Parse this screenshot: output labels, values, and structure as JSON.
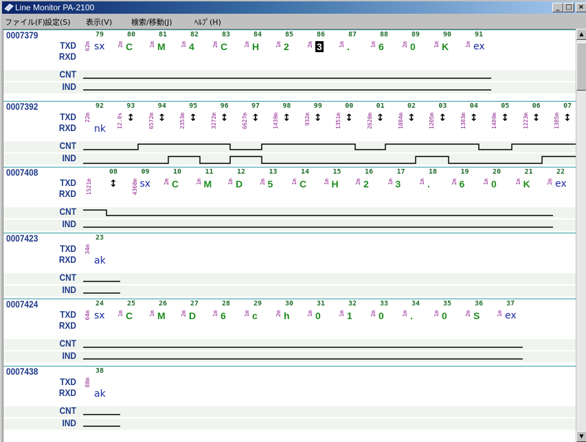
{
  "window": {
    "title": "Line Monitor PA-2100"
  },
  "menu": [
    "ファイル(F)",
    "設定(S)",
    "表示(V)",
    "検索/移動(J)",
    "ﾍﾙﾌﾟ(H)"
  ],
  "labels": [
    "TXD",
    "RXD",
    "CNT",
    "IND"
  ],
  "blocks": [
    {
      "id": "0007379",
      "first_time": "62m",
      "cells": [
        {
          "i": "79",
          "c": "sx",
          "ctl": true
        },
        {
          "i": "80",
          "t": "2m",
          "c": "C"
        },
        {
          "i": "81",
          "t": "1m",
          "c": "M"
        },
        {
          "i": "82",
          "t": "1m",
          "c": "4"
        },
        {
          "i": "83",
          "t": "2m",
          "c": "C"
        },
        {
          "i": "84",
          "t": "1m",
          "c": "H"
        },
        {
          "i": "85",
          "t": "1m",
          "c": "2"
        },
        {
          "i": "86",
          "t": "2m",
          "c": "3",
          "hl": true
        },
        {
          "i": "87",
          "t": "1m",
          "c": "."
        },
        {
          "i": "88",
          "t": "1m",
          "c": "6"
        },
        {
          "i": "89",
          "t": "2m",
          "c": "0"
        },
        {
          "i": "90",
          "t": "1m",
          "c": "K"
        },
        {
          "i": "91",
          "t": "1m",
          "c": "ex",
          "ctl": true
        }
      ]
    },
    {
      "id": "0007392",
      "first_time": "22m",
      "cells": [
        {
          "i": "92",
          "c": "nk",
          "ctl": true,
          "rx": true
        },
        {
          "i": "93",
          "t": "12.0s",
          "arrow": true
        },
        {
          "i": "94",
          "t": "6572m",
          "arrow": true
        },
        {
          "i": "95",
          "t": "2353m",
          "arrow": true
        },
        {
          "i": "96",
          "t": "3272m",
          "arrow": true
        },
        {
          "i": "97",
          "t": "6627m",
          "arrow": true
        },
        {
          "i": "98",
          "t": "1439m",
          "arrow": true
        },
        {
          "i": "99",
          "t": "932m",
          "arrow": true
        },
        {
          "i": "00",
          "t": "1351m",
          "arrow": true
        },
        {
          "i": "01",
          "t": "2620m",
          "arrow": true
        },
        {
          "i": "02",
          "t": "1084m",
          "arrow": true
        },
        {
          "i": "03",
          "t": "1205m",
          "arrow": true
        },
        {
          "i": "04",
          "t": "1383m",
          "arrow": true
        },
        {
          "i": "05",
          "t": "1489m",
          "arrow": true
        },
        {
          "i": "06",
          "t": "1223m",
          "arrow": true
        },
        {
          "i": "07",
          "t": "1385m",
          "arrow": true
        }
      ]
    },
    {
      "id": "0007408",
      "first_time": "1521m",
      "cells": [
        {
          "i": "08",
          "arrow": true
        },
        {
          "i": "09",
          "t": "4368m",
          "c": "sx",
          "ctl": true
        },
        {
          "i": "10",
          "t": "2m",
          "c": "C"
        },
        {
          "i": "11",
          "t": "1m",
          "c": "M"
        },
        {
          "i": "12",
          "t": "1m",
          "c": "D"
        },
        {
          "i": "13",
          "t": "2m",
          "c": "5"
        },
        {
          "i": "14",
          "t": "1m",
          "c": "C"
        },
        {
          "i": "15",
          "t": "1m",
          "c": "H"
        },
        {
          "i": "16",
          "t": "2m",
          "c": "2"
        },
        {
          "i": "17",
          "t": "1m",
          "c": "3"
        },
        {
          "i": "18",
          "t": "1m",
          "c": "."
        },
        {
          "i": "19",
          "t": "2m",
          "c": "6"
        },
        {
          "i": "20",
          "t": "1m",
          "c": "0"
        },
        {
          "i": "21",
          "t": "1m",
          "c": "K"
        },
        {
          "i": "22",
          "t": "2m",
          "c": "ex",
          "ctl": true
        }
      ]
    },
    {
      "id": "0007423",
      "first_time": "34m",
      "cells": [
        {
          "i": "23",
          "c": "ak",
          "ctl": true,
          "rx": true
        }
      ]
    },
    {
      "id": "0007424",
      "first_time": "64m",
      "cells": [
        {
          "i": "24",
          "c": "sx",
          "ctl": true
        },
        {
          "i": "25",
          "t": "1m",
          "c": "C"
        },
        {
          "i": "26",
          "t": "1m",
          "c": "M"
        },
        {
          "i": "27",
          "t": "2m",
          "c": "D"
        },
        {
          "i": "28",
          "t": "1m",
          "c": "6"
        },
        {
          "i": "29",
          "t": "1m",
          "c": "c"
        },
        {
          "i": "30",
          "t": "2m",
          "c": "h"
        },
        {
          "i": "31",
          "t": "1m",
          "c": "0"
        },
        {
          "i": "32",
          "t": "1m",
          "c": "1"
        },
        {
          "i": "33",
          "t": "2m",
          "c": "0"
        },
        {
          "i": "34",
          "t": "1m",
          "c": "."
        },
        {
          "i": "35",
          "t": "1m",
          "c": "0"
        },
        {
          "i": "36",
          "t": "2m",
          "c": "S"
        },
        {
          "i": "37",
          "t": "1m",
          "c": "ex",
          "ctl": true
        }
      ]
    },
    {
      "id": "0007438",
      "first_time": "88m",
      "cells": [
        {
          "i": "38",
          "c": "ak",
          "ctl": true,
          "rx": true
        }
      ]
    }
  ],
  "colors": {
    "separator": "#2e9aa2",
    "label": "#1e3a8a",
    "index": "#1e6b2a",
    "time": "#8b1a8b",
    "char": "#1e8c1e",
    "control": "#1a2aa0",
    "band": "#f0f4ee"
  }
}
